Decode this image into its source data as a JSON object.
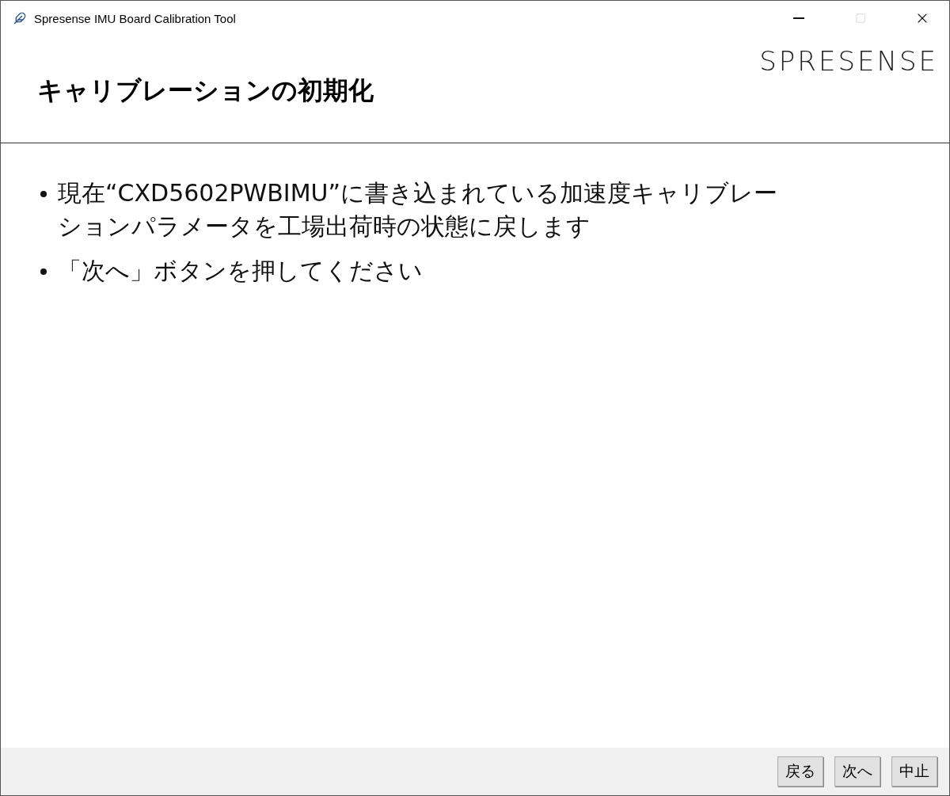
{
  "window": {
    "title": "Spresense IMU Board Calibration Tool",
    "maximize_disabled": true
  },
  "header": {
    "title": "キャリブレーションの初期化",
    "logo": "SPRESENSE"
  },
  "bullets": [
    "現在“CXD5602PWBIMU”に書き込まれている加速度キャリブレーションパラメータを工場出荷時の状態に戻します",
    "「次へ」ボタンを押してください"
  ],
  "buttons": [
    "戻る",
    "次へ",
    "中止"
  ]
}
